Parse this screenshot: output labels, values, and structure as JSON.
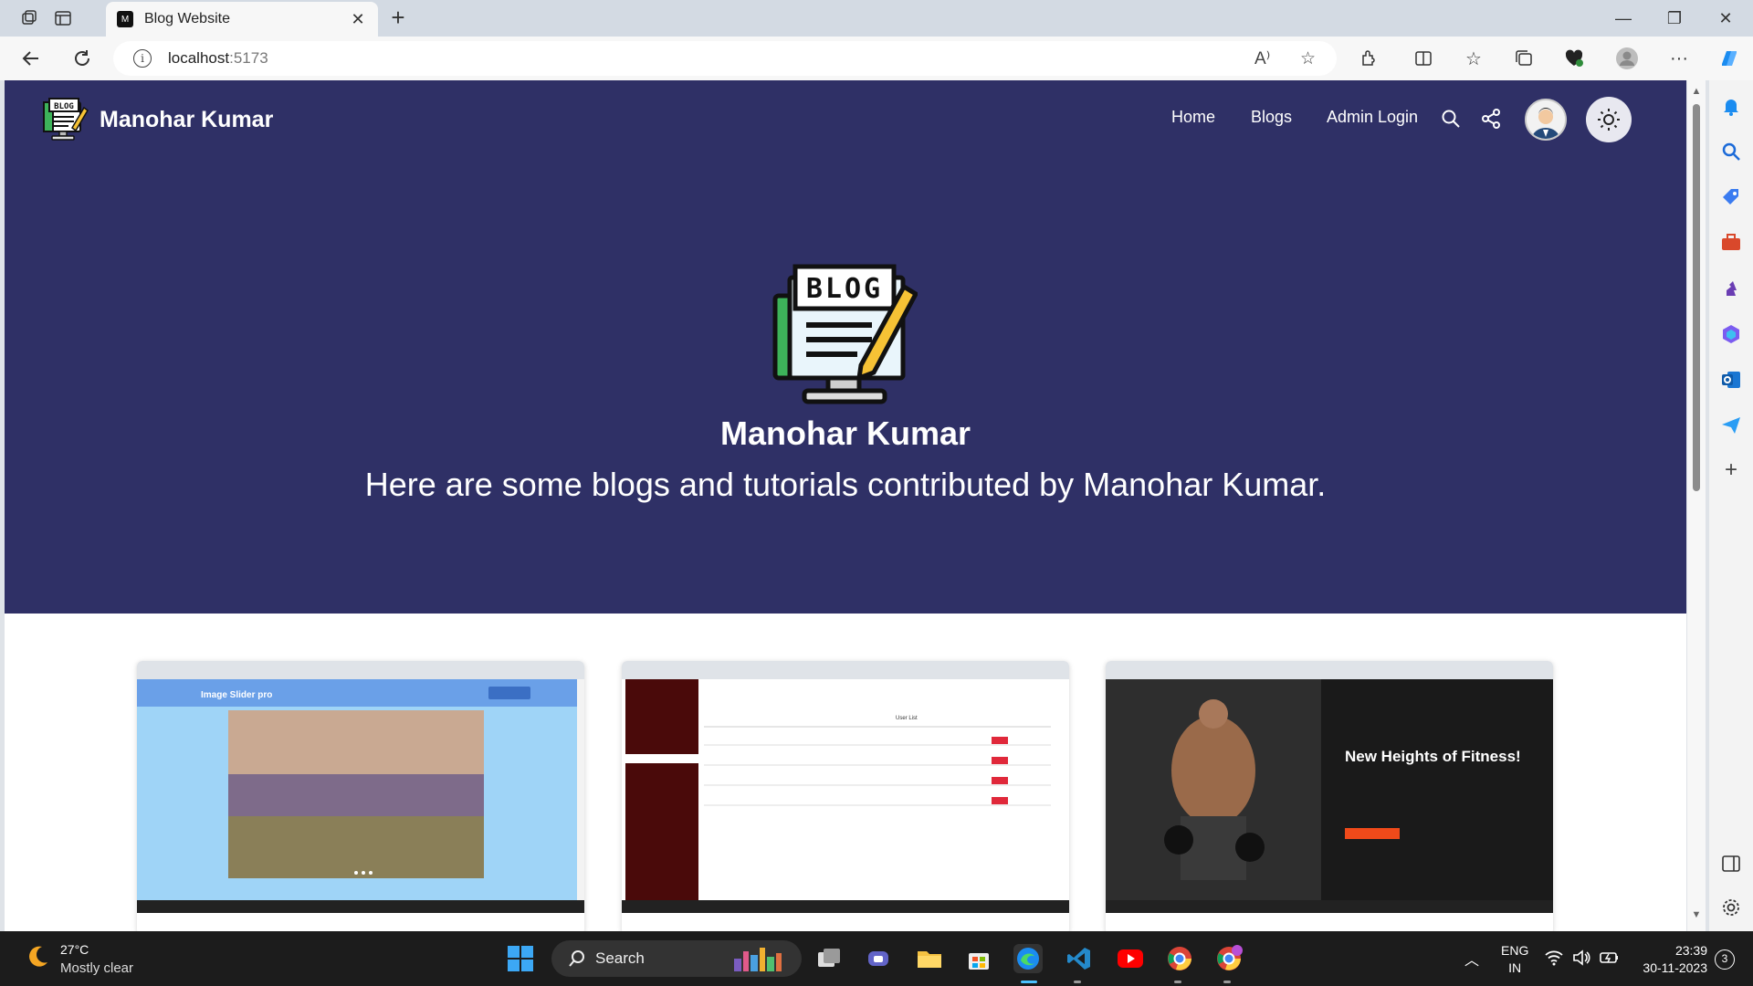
{
  "browser": {
    "tab_title": "Blog Website",
    "url_host": "localhost",
    "url_port": ":5173"
  },
  "site": {
    "brand_name": "Manohar Kumar",
    "nav": {
      "home": "Home",
      "blogs": "Blogs",
      "admin_login": "Admin Login"
    },
    "logo_text": "BLOG",
    "hero_title": "Manohar Kumar",
    "hero_subtitle": "Here are some blogs and tutorials contributed by Manohar Kumar.",
    "cards": [
      {
        "thumbnail": "Image Slider pro app screenshot",
        "thumb_title": "Image Slider pro",
        "accent": "#6aa0e8"
      },
      {
        "thumbnail": "Teacher Student dashboard screenshot",
        "thumb_title": "User List",
        "accent": "#4a0a0a"
      },
      {
        "thumbnail": "Gym website screenshot",
        "thumb_title": "New Heights of Fitness!",
        "accent": "#f04a1a"
      }
    ]
  },
  "taskbar": {
    "weather_temp": "27°C",
    "weather_desc": "Mostly clear",
    "search_label": "Search",
    "lang_top": "ENG",
    "lang_bottom": "IN",
    "time": "23:39",
    "date": "30-11-2023",
    "notification_count": "3"
  },
  "colors": {
    "nav_bg": "#2f3066",
    "hero_bg": "#2f3066",
    "page_bg": "#ffffff"
  }
}
